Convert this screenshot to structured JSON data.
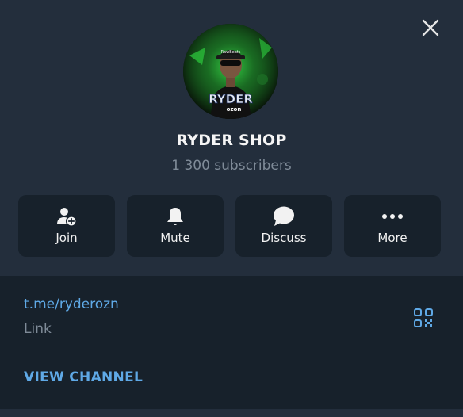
{
  "channel": {
    "name": "RYDER SHOP",
    "subscribers": "1 300 subscribers",
    "avatar_text": "RYDER",
    "avatar_subtext": "ozon"
  },
  "actions": [
    {
      "label": "Join",
      "icon": "add-user-icon"
    },
    {
      "label": "Mute",
      "icon": "bell-icon"
    },
    {
      "label": "Discuss",
      "icon": "chat-bubble-icon"
    },
    {
      "label": "More",
      "icon": "more-dots-icon"
    }
  ],
  "info": {
    "link": "t.me/ryderozn",
    "link_caption": "Link",
    "view_channel_label": "VIEW CHANNEL"
  },
  "colors": {
    "header_bg": "#232e3c",
    "body_bg": "#17212b",
    "accent": "#5fa9e6",
    "muted_text": "#7f8b98",
    "avatar_glow": "#39e04a"
  }
}
